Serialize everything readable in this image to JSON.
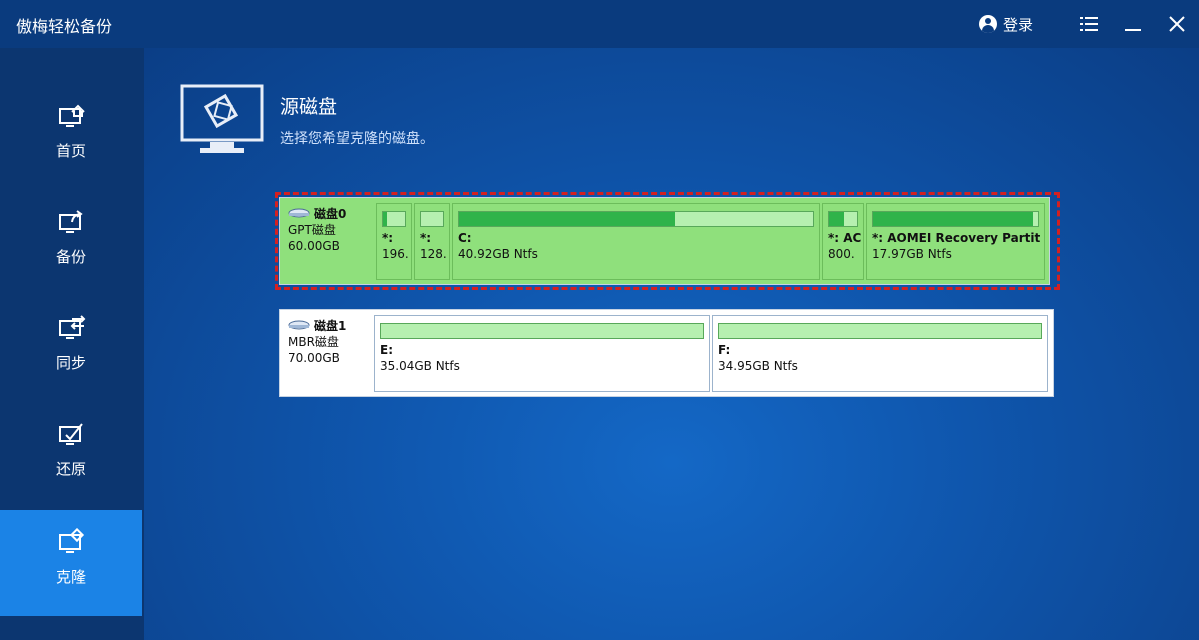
{
  "app": {
    "title": "傲梅轻松备份"
  },
  "titlebar": {
    "login_label": "登录"
  },
  "sidebar": {
    "items": [
      {
        "label": "首页",
        "icon": "home-icon",
        "active": false
      },
      {
        "label": "备份",
        "icon": "backup-icon",
        "active": false
      },
      {
        "label": "同步",
        "icon": "sync-icon",
        "active": false
      },
      {
        "label": "还原",
        "icon": "restore-icon",
        "active": false
      },
      {
        "label": "克隆",
        "icon": "clone-icon",
        "active": true
      }
    ]
  },
  "section": {
    "title": "源磁盘",
    "subtitle": "选择您希望克隆的磁盘。"
  },
  "disks": [
    {
      "name": "磁盘0",
      "style": "GPT磁盘",
      "size": "60.00GB",
      "selected": true,
      "partitions": [
        {
          "label": "*:",
          "size": "196.",
          "fill": 0.2
        },
        {
          "label": "*:",
          "size": "128.",
          "fill": 0.0
        },
        {
          "label": "C:",
          "size": "40.92GB Ntfs",
          "fill": 0.61
        },
        {
          "label": "*: AC",
          "size": "800.",
          "fill": 0.55
        },
        {
          "label": "*: AOMEI Recovery Partit",
          "size": "17.97GB Ntfs",
          "fill": 0.97
        }
      ]
    },
    {
      "name": "磁盘1",
      "style": "MBR磁盘",
      "size": "70.00GB",
      "selected": false,
      "partitions": [
        {
          "label": "E:",
          "size": "35.04GB Ntfs",
          "fill": 0.0
        },
        {
          "label": "F:",
          "size": "34.95GB Ntfs",
          "fill": 0.0
        }
      ]
    }
  ],
  "colors": {
    "accent": "#1b83e6",
    "selected_disk": "#8fe07c",
    "selection_border": "#d42020",
    "bar_fill": "#2fb34a"
  }
}
